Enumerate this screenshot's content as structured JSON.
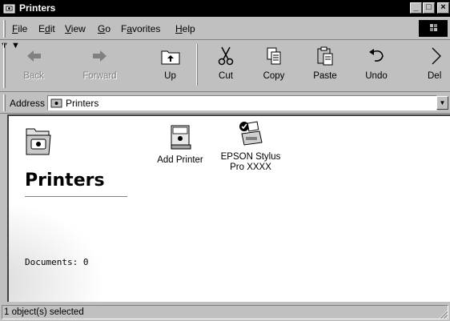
{
  "window": {
    "title": "Printers"
  },
  "titlebar": {
    "minimize": "_",
    "maximize": "□",
    "close": "×"
  },
  "menu": [
    "File",
    "Edit",
    "View",
    "Go",
    "Favorites",
    "Help"
  ],
  "toolbar": {
    "back": "Back",
    "forward": "Forward",
    "up": "Up",
    "cut": "Cut",
    "copy": "Copy",
    "paste": "Paste",
    "undo": "Undo",
    "delete": "Del"
  },
  "address": {
    "label": "Address",
    "value": "Printers"
  },
  "webview": {
    "heading": "Printers",
    "documents": "Documents: 0"
  },
  "items": [
    {
      "name": "Add Printer",
      "name_line2": ""
    },
    {
      "name": "EPSON Stylus",
      "name_line2": "Pro XXXX"
    }
  ],
  "status": {
    "text": "1 object(s) selected"
  },
  "icons": {
    "app": "printer-folder-icon",
    "back": "back-arrow-icon",
    "forward": "forward-arrow-icon",
    "up": "up-folder-icon",
    "cut": "scissors-icon",
    "copy": "copy-icon",
    "paste": "paste-icon",
    "undo": "undo-icon",
    "delete": "delete-icon",
    "windows_logo": "windows-logo-icon"
  }
}
